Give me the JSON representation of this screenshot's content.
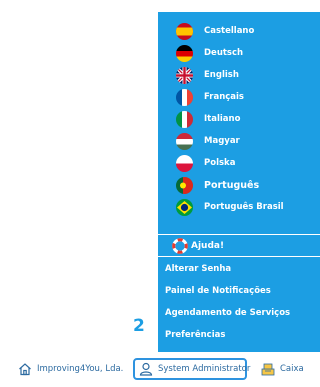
{
  "languages": [
    {
      "label": "Castellano",
      "flag_icon": "spain-flag-icon"
    },
    {
      "label": "Deutsch",
      "flag_icon": "germany-flag-icon"
    },
    {
      "label": "English",
      "flag_icon": "uk-flag-icon"
    },
    {
      "label": "Français",
      "flag_icon": "france-flag-icon"
    },
    {
      "label": "Italiano",
      "flag_icon": "italy-flag-icon"
    },
    {
      "label": "Magyar",
      "flag_icon": "hungary-flag-icon"
    },
    {
      "label": "Polska",
      "flag_icon": "poland-flag-icon"
    },
    {
      "label": "Português",
      "flag_icon": "portugal-flag-icon"
    },
    {
      "label": "Português Brasil",
      "flag_icon": "brazil-flag-icon"
    }
  ],
  "help": {
    "label": "Ajuda!",
    "icon": "lifebuoy-icon"
  },
  "menu_items": [
    "Alterar Senha",
    "Painel de Notificações",
    "Agendamento de Serviços",
    "Preferências"
  ],
  "badge": "2",
  "bottom_bar": {
    "company": "Improving4You, Lda.",
    "user": "System Administrator",
    "cash": "Caixa"
  },
  "colors": {
    "menu_bg": "#1c9ee3",
    "text_link": "#2c6aa0",
    "highlight_border": "#2e93df"
  }
}
